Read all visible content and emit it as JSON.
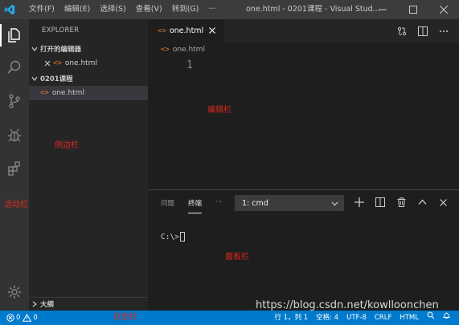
{
  "titlebar": {
    "menu": [
      "文件(F)",
      "编辑(E)",
      "选择(S)",
      "查看(V)",
      "转到(G)",
      "···"
    ],
    "title": "one.html - 0201课程 - Visual Stud..."
  },
  "sidebar": {
    "title": "EXPLORER",
    "open_editors": {
      "label": "打开的编辑器",
      "files": [
        "one.html"
      ]
    },
    "folder": {
      "label": "0201课程",
      "files": [
        "one.html"
      ]
    },
    "outline_label": "大纲"
  },
  "editor": {
    "tab_label": "one.html",
    "breadcrumb": "one.html",
    "line_number": "1"
  },
  "panel": {
    "tabs": [
      "问题",
      "终端",
      "···"
    ],
    "terminal_select": "1: cmd",
    "prompt": "C:\\>"
  },
  "annotations": {
    "editor": "编辑栏",
    "sidebar": "侧边栏",
    "activitybar": "活动栏",
    "panel": "面板栏",
    "statusbar": "状态栏"
  },
  "statusbar": {
    "problems": "0",
    "warnings": "0",
    "position": "行 1，列 1",
    "spaces": "空格: 4",
    "encoding": "UTF-8",
    "eol": "CRLF",
    "language": "HTML"
  },
  "watermark": "https://blog.csdn.net/kowlloonchen",
  "colors": {
    "accent": "#007acc",
    "annotation": "#e0281e",
    "file_icon": "#e37933"
  }
}
